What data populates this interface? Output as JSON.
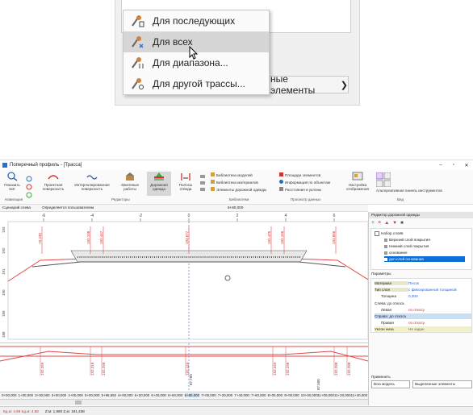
{
  "popup": {
    "bottom_button_label": "ные элементы",
    "menu_items": [
      {
        "label": "Для последующих"
      },
      {
        "label": "Для всех",
        "selected": true
      },
      {
        "label": "Для диапазона..."
      },
      {
        "label": "Для другой трассы..."
      }
    ]
  },
  "window": {
    "title": "Поперечный профиль - [Трасса]",
    "controls": [
      "–",
      "▫",
      "✕"
    ]
  },
  "ribbon": {
    "buttons": [
      {
        "label": "Показать всё"
      },
      {
        "label": "Проектная поверхность"
      },
      {
        "label": "Интерполированная поверхность"
      },
      {
        "label": "Земляные работы"
      },
      {
        "label": "Дорожная одежда"
      },
      {
        "label": "Полосы отвода"
      }
    ],
    "groups": [
      "Навигация",
      "Редакторы",
      "Библиотеки",
      "Просмотр данных",
      "Вид"
    ],
    "library_items": [
      "Библиотека моделей",
      "Библиотека материалов",
      "Элементы дорожной одежды"
    ],
    "view_items": [
      "Площади элементов",
      "Информация по объектам",
      "Расстояния и уклоны"
    ],
    "settings_label": "Настройка отображения",
    "alt_panel_label": "Альтернативная панель инструментов"
  },
  "context": {
    "left_label": "Сценарий слева",
    "mid_label": "Определяется пользователем",
    "station": "6+80,000",
    "right_label": "Определяется пользователем",
    "right_scenario": "Сценарий справа"
  },
  "chart_data": {
    "type": "cross-section",
    "station": "6+80,000",
    "top_labels": [
      "-6",
      "-4",
      "-2",
      "0",
      "2",
      "4",
      "6"
    ],
    "y_labels": [
      "193",
      "192",
      "191",
      "190",
      "189",
      "188"
    ],
    "top_elevations": [
      "+0.230",
      "192.108",
      "192.447",
      "193.677",
      "192.475",
      "192.166",
      "193.866"
    ],
    "lower_values": [
      "192.269",
      "192.318",
      "192.298",
      "192.449",
      "193.349",
      "192.298",
      "192.288",
      "192.288"
    ],
    "center_label": "87.750",
    "center_label2": "87.500"
  },
  "stations": [
    "0+00,000",
    "1+00,000",
    "2+00,000",
    "3+00,000",
    "4+00,000",
    "5+00,000",
    "5+96,692",
    "6+00,000",
    "6+20,000",
    "6+40,000",
    "6+60,000",
    "6+80,000",
    "7+00,000",
    "7+20,000",
    "7+40,000",
    "7+60,000",
    "8+00,000",
    "9+00,000",
    "10+00,000",
    "11+00,000",
    "11+20,000",
    "11+40,000"
  ],
  "status": {
    "coords": "Кд.м: 4,68   Кд.м: 4,68",
    "scale": "Z:м: 1,980  Z,м: 191,438"
  },
  "rpanel": {
    "title": "Редактор дорожной одежды",
    "tree": [
      "Набор слоёв",
      "Верхний слой покрытия",
      "Нижний слой покрытия",
      "основание",
      "доп.слой основания"
    ],
    "params_title": "Параметры",
    "props": [
      {
        "k": "Материал",
        "v": "Песок"
      },
      {
        "k": "Тип слоя",
        "v": "с фиксированной толщиной"
      },
      {
        "k": "Толщина",
        "v": "0,300"
      },
      {
        "k": "Слева: до откоса",
        "v": ""
      },
      {
        "k": "Левая",
        "v": "по откосу"
      },
      {
        "k": "Справа: до откоса",
        "v": ""
      },
      {
        "k": "Правая",
        "v": "по откосу"
      },
      {
        "k": "Уклон низа",
        "v": "Не задан"
      }
    ],
    "apply_label": "Применить",
    "apply_left": "Всю модель",
    "apply_right": "Выделенные элементы"
  }
}
